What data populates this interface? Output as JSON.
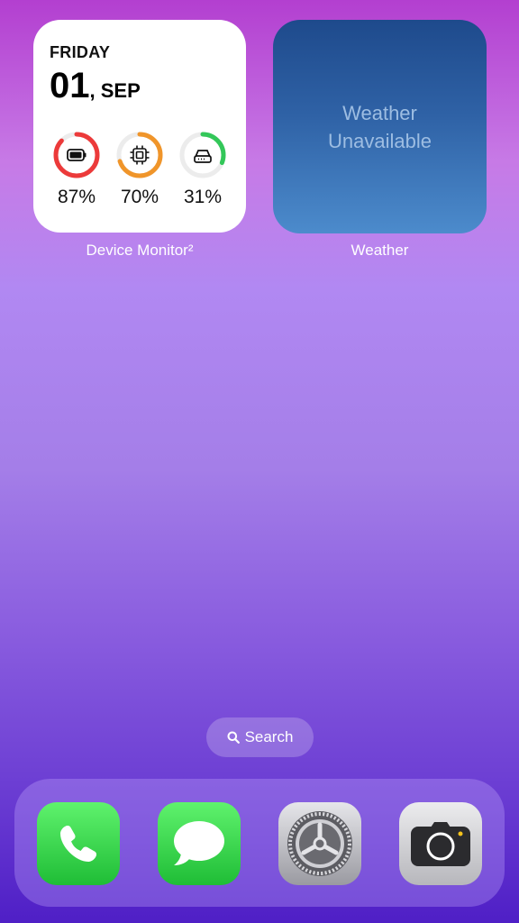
{
  "device_monitor": {
    "day": "FRIDAY",
    "date_num": "01",
    "date_month": ", SEP",
    "label": "Device Monitor²",
    "rings": [
      {
        "name": "battery",
        "icon": "battery-icon",
        "value": "87%",
        "fraction": 0.87,
        "color": "#ec3a3a"
      },
      {
        "name": "cpu",
        "icon": "cpu-chip-icon",
        "value": "70%",
        "fraction": 0.7,
        "color": "#f0952a"
      },
      {
        "name": "storage",
        "icon": "storage-drive-icon",
        "value": "31%",
        "fraction": 0.31,
        "color": "#33c759"
      }
    ]
  },
  "weather": {
    "line1": "Weather",
    "line2": "Unavailable",
    "label": "Weather"
  },
  "search": {
    "label": "Search",
    "icon": "search-icon"
  },
  "dock": {
    "apps": [
      {
        "name": "phone",
        "icon": "phone-icon"
      },
      {
        "name": "messages",
        "icon": "messages-icon"
      },
      {
        "name": "settings",
        "icon": "settings-gear-icon"
      },
      {
        "name": "camera",
        "icon": "camera-icon"
      }
    ]
  },
  "colors": {
    "ring_track": "#ececec",
    "weather_text": "#9dbde2"
  }
}
